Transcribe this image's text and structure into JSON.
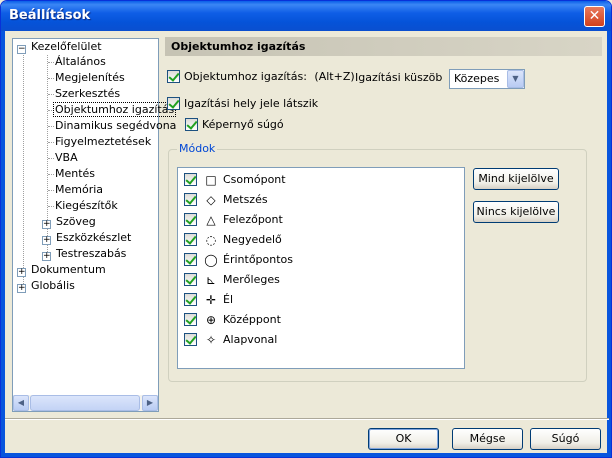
{
  "window": {
    "title": "Beállítások",
    "close_label": "✕"
  },
  "tree": {
    "items": [
      {
        "label": "Kezelőfelület",
        "level": 0,
        "expander": "−"
      },
      {
        "label": "Általános",
        "level": 1
      },
      {
        "label": "Megjelenítés",
        "level": 1
      },
      {
        "label": "Szerkesztés",
        "level": 1
      },
      {
        "label": "Objektumhoz igazítás",
        "level": 1,
        "selected": true
      },
      {
        "label": "Dinamikus segédvona",
        "level": 1
      },
      {
        "label": "Figyelmeztetések",
        "level": 1
      },
      {
        "label": "VBA",
        "level": 1
      },
      {
        "label": "Mentés",
        "level": 1
      },
      {
        "label": "Memória",
        "level": 1
      },
      {
        "label": "Kiegészítők",
        "level": 1
      },
      {
        "label": "Szöveg",
        "level": 1,
        "expander": "+"
      },
      {
        "label": "Eszközkészlet",
        "level": 1,
        "expander": "+"
      },
      {
        "label": "Testreszabás",
        "level": 1,
        "expander": "+"
      },
      {
        "label": "Dokumentum",
        "level": 0,
        "expander": "+"
      },
      {
        "label": "Globális",
        "level": 0,
        "expander": "+"
      }
    ],
    "scroll_left": "◀",
    "scroll_right": "▶"
  },
  "panel": {
    "header": "Objektumhoz igazítás",
    "snap_enabled": {
      "label": "Objektumhoz igazítás:",
      "shortcut": "(Alt+Z)",
      "checked": true
    },
    "threshold_label": "Igazítási küszöb",
    "threshold_value": "Közepes",
    "threshold_drop": "▼",
    "show_marker": {
      "label": "Igazítási hely jele látszik",
      "checked": true
    },
    "tooltip": {
      "label": "Képernyő súgó",
      "checked": true
    },
    "modes": {
      "legend": "Módok",
      "items": [
        {
          "label": "Csomópont",
          "icon": "□",
          "checked": true
        },
        {
          "label": "Metszés",
          "icon": "◇",
          "checked": true
        },
        {
          "label": "Felezőpont",
          "icon": "△",
          "checked": true
        },
        {
          "label": "Negyedelő",
          "icon": "◌",
          "checked": true
        },
        {
          "label": "Érintőpontos",
          "icon": "◯",
          "checked": true
        },
        {
          "label": "Merőleges",
          "icon": "⊾",
          "checked": true
        },
        {
          "label": "Él",
          "icon": "✛",
          "checked": true
        },
        {
          "label": "Középpont",
          "icon": "⊕",
          "checked": true
        },
        {
          "label": "Alapvonal",
          "icon": "✧",
          "checked": true
        }
      ],
      "select_all": "Mind kijelölve",
      "select_none": "Nincs kijelölve"
    }
  },
  "footer": {
    "ok": "OK",
    "cancel": "Mégse",
    "help": "Súgó"
  }
}
